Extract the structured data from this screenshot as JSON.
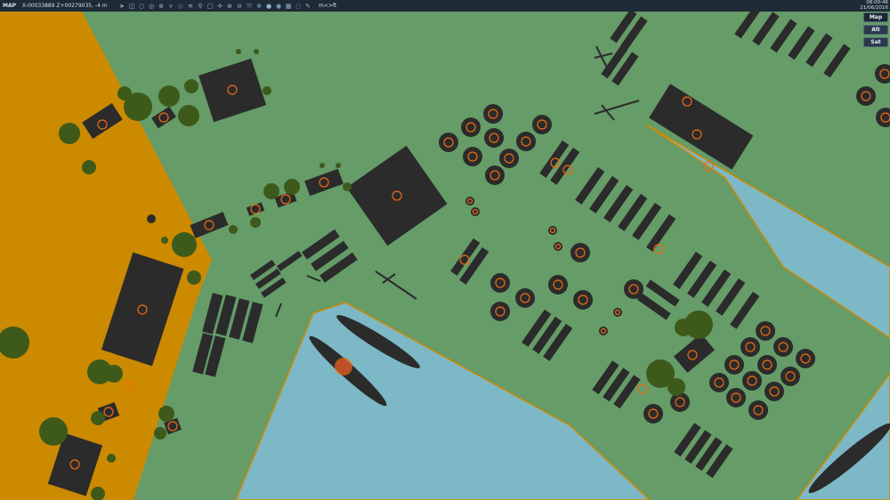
{
  "topbar": {
    "mode_label": "MAP",
    "coords_text": "X-00033889 Z+00279035, -4 m",
    "scale_text": "m<>ft",
    "time": "08:00:46",
    "date": "21/06/2016",
    "icons": [
      "waypoint-icon",
      "gps-icon",
      "circle-icon",
      "vehicle-icon",
      "marker-icon",
      "route-icon",
      "diamond-icon",
      "signal-icon",
      "tower-icon",
      "chat-icon",
      "crosshair-icon",
      "zoom-in-icon",
      "zoom-out-icon",
      "pan-icon",
      "settings-icon",
      "globe-icon",
      "globe-alt-icon",
      "grid-icon",
      "layers-icon",
      "pencil-icon"
    ]
  },
  "layer_buttons": [
    {
      "label": "Map",
      "active": true
    },
    {
      "label": "Alt",
      "active": false
    },
    {
      "label": "Sat",
      "active": false
    }
  ],
  "colors": {
    "grass": "#659c68",
    "sand": "#cc8a00",
    "water": "#7cb8c6",
    "building": "#2b2b2b",
    "marker": "#ee6b12",
    "tree": "#3d5a1a"
  }
}
